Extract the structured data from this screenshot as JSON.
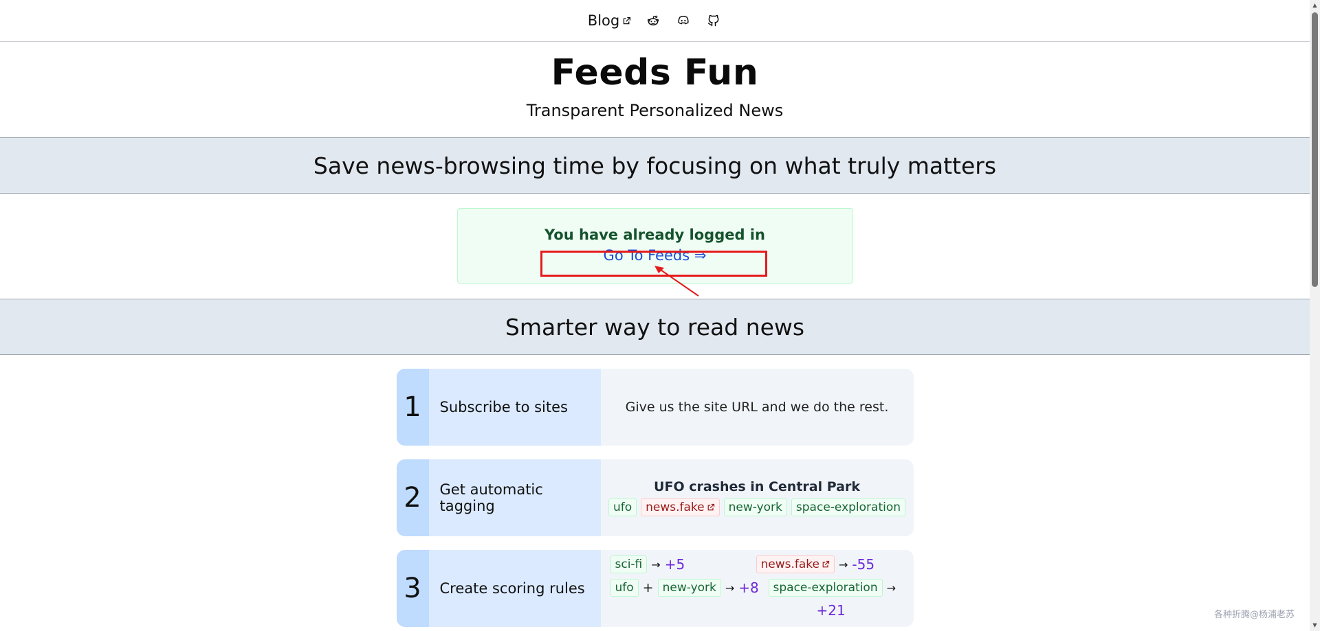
{
  "nav": {
    "blog_label": "Blog",
    "icons": [
      "external-link-icon",
      "reddit-icon",
      "discord-icon",
      "github-icon"
    ]
  },
  "header": {
    "title": "Feeds Fun",
    "subtitle": "Transparent Personalized News"
  },
  "band_1": {
    "text": "Save news-browsing time by focusing on what truly matters"
  },
  "login": {
    "message": "You have already logged in",
    "link_label": "Go To Feeds ⇒"
  },
  "band_2": {
    "text": "Smarter way to read news"
  },
  "steps": [
    {
      "number": "1",
      "label": "Subscribe to sites",
      "body": "Give us the site URL and we do the rest."
    },
    {
      "number": "2",
      "label": "Get automatic tagging",
      "news_title": "UFO crashes in Central Park",
      "tags": [
        {
          "text": "ufo",
          "color": "green"
        },
        {
          "text": "news.fake",
          "color": "red"
        },
        {
          "text": "new-york",
          "color": "green"
        },
        {
          "text": "space-exploration",
          "color": "green"
        }
      ]
    },
    {
      "number": "3",
      "label": "Create scoring rules",
      "rules": {
        "r1_tag": "sci-fi",
        "r1_arrow": "→",
        "r1_score": "+5",
        "r2_tag": "news.fake",
        "r2_arrow": "→",
        "r2_score": "-55",
        "r3_tag1": "ufo",
        "r3_plus": "+",
        "r3_tag2": "new-york",
        "r3_arrow": "→",
        "r3_score": "+8",
        "r4_tag": "space-exploration",
        "r4_arrow": "→",
        "r4_score": "+21"
      }
    }
  ],
  "watermark": "各种折腾@杨浦老苏",
  "colors": {
    "band_bg": "#e2e8f0",
    "login_bg": "#f0fdf4",
    "link": "#1d4ed8",
    "score": "#6d28d9",
    "highlight": "#e51b1b"
  }
}
